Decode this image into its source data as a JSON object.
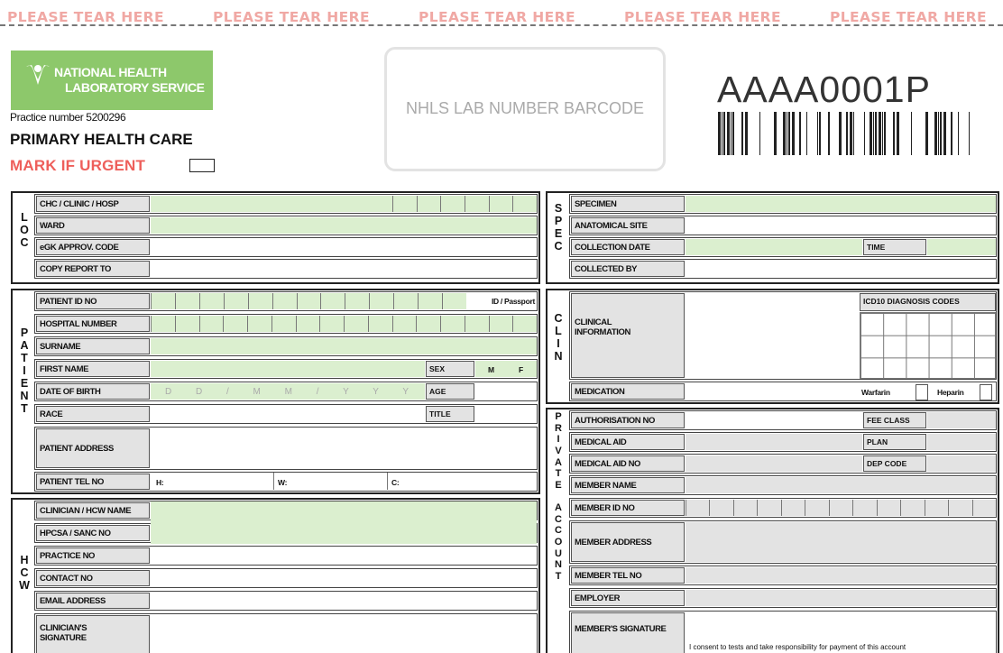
{
  "tear": "PLEASE TEAR HERE",
  "org": {
    "line1": "NATIONAL HEALTH",
    "line2": "LABORATORY SERVICE",
    "practice": "Practice number 5200296",
    "title": "PRIMARY HEALTH CARE",
    "urgent": "MARK IF URGENT"
  },
  "barcode": {
    "label": "NHLS LAB NUMBER BARCODE",
    "number": "AAAA0001P"
  },
  "loc": {
    "letters": "L\nO\nC",
    "rows": [
      "CHC / CLINIC / HOSP",
      "WARD",
      "eGK APPROV. CODE",
      "COPY REPORT TO"
    ]
  },
  "patient": {
    "letters": "P\nA\nT\nI\nE\nN\nT",
    "id_no": "PATIENT ID NO",
    "id_passport": "ID / Passport",
    "hospital_no": "HOSPITAL NUMBER",
    "surname": "SURNAME",
    "first_name": "FIRST NAME",
    "sex": "SEX",
    "m": "M",
    "f": "F",
    "dob": "DATE OF BIRTH",
    "dob_mask": "D D / M M / Y Y Y Y",
    "age": "AGE",
    "race": "RACE",
    "title": "TITLE",
    "address": "PATIENT ADDRESS",
    "tel": "PATIENT TEL NO",
    "h": "H:",
    "w": "W:",
    "c": "C:"
  },
  "hcw": {
    "letters": "H\nC\nW",
    "rows": [
      "CLINICIAN / HCW NAME",
      "HPCSA / SANC NO",
      "PRACTICE NO",
      "CONTACT NO",
      "EMAIL ADDRESS"
    ],
    "signature": "CLINICIAN'S\nSIGNATURE"
  },
  "spec": {
    "letters": "S\nP\nE\nC",
    "specimen": "SPECIMEN",
    "site": "ANATOMICAL SITE",
    "date": "COLLECTION DATE",
    "time": "TIME",
    "by": "COLLECTED BY"
  },
  "clin": {
    "letters": "C\nL\nI\nN",
    "info": "CLINICAL\nINFORMATION",
    "icd": "ICD10 DIAGNOSIS CODES",
    "medication": "MEDICATION",
    "warfarin": "Warfarin",
    "heparin": "Heparin"
  },
  "account": {
    "letters": "P\nR\nI\nV\nA\nT\nE\n\nA\nC\nC\nO\nU\nN\nT",
    "auth": "AUTHORISATION NO",
    "fee": "FEE CLASS",
    "aid": "MEDICAL AID",
    "plan": "PLAN",
    "aid_no": "MEDICAL AID NO",
    "dep": "DEP CODE",
    "member_name": "MEMBER NAME",
    "member_id": "MEMBER ID NO",
    "member_addr": "MEMBER ADDRESS",
    "member_tel": "MEMBER TEL NO",
    "employer": "EMPLOYER",
    "member_sig": "MEMBER'S SIGNATURE",
    "consent": "I consent to tests and take responsibility for payment of this account"
  },
  "colors": {
    "green": "#8dc86b",
    "field_green": "#dbefcf",
    "urgent_red": "#ee5f5b",
    "tear_pink": "#f0a8a4"
  }
}
